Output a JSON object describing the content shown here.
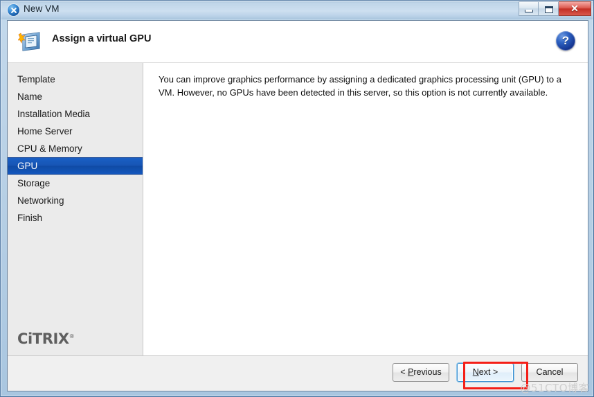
{
  "window": {
    "title": "New VM",
    "title_icon": "blue-x-circle-icon",
    "minimize_label": "–",
    "maximize_label": "□",
    "close_label": "✕"
  },
  "header": {
    "title": "Assign a virtual GPU",
    "icon": "vm-wizard-icon",
    "help_label": "?"
  },
  "sidebar": {
    "steps": [
      {
        "label": "Template",
        "selected": false
      },
      {
        "label": "Name",
        "selected": false
      },
      {
        "label": "Installation Media",
        "selected": false
      },
      {
        "label": "Home Server",
        "selected": false
      },
      {
        "label": "CPU & Memory",
        "selected": false
      },
      {
        "label": "GPU",
        "selected": true
      },
      {
        "label": "Storage",
        "selected": false
      },
      {
        "label": "Networking",
        "selected": false
      },
      {
        "label": "Finish",
        "selected": false
      }
    ],
    "logo_text": "CiTRIX",
    "logo_mark": "®"
  },
  "content": {
    "paragraph": "You can improve graphics performance by assigning a dedicated graphics processing unit (GPU) to a VM. However, no GPUs have been detected in this server, so this option is not currently available."
  },
  "footer": {
    "buttons": [
      {
        "label_prefix": "< ",
        "accel": "P",
        "label_rest": "revious",
        "label_suffix": "",
        "focused": false
      },
      {
        "label_prefix": "",
        "accel": "N",
        "label_rest": "ext",
        "label_suffix": " >",
        "focused": true
      },
      {
        "label_prefix": "",
        "accel": "C",
        "label_rest": "ancel",
        "label_suffix": "",
        "focused": false
      }
    ]
  },
  "annotation": {
    "highlight_color": "#f41f18",
    "highlight_target": "next-button"
  },
  "watermark": {
    "text": "@51CTO博客"
  },
  "colors": {
    "selection_blue": "#1755b4",
    "sidebar_bg": "#ebebeb",
    "footer_bg": "#f0f0f0",
    "help_blue": "#14348f"
  }
}
